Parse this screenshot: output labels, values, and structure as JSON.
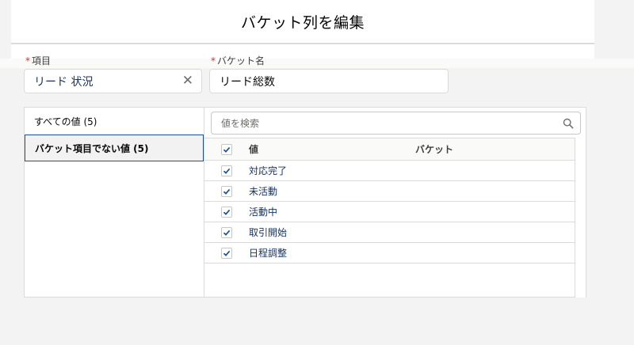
{
  "header": {
    "title": "バケット列を編集"
  },
  "fields": {
    "item": {
      "required_mark": "*",
      "label": "項目",
      "value": "リード 状況"
    },
    "bucket_name": {
      "required_mark": "*",
      "label": "バケット名",
      "value": "リード総数"
    }
  },
  "left_list": {
    "items": [
      {
        "label": "すべての値 (5)"
      },
      {
        "label": "バケット項目でない値 (5)"
      }
    ]
  },
  "search": {
    "placeholder": "値を検索"
  },
  "table": {
    "headers": {
      "value": "値",
      "bucket": "バケット"
    },
    "rows": [
      {
        "value": "対応完了",
        "bucket": ""
      },
      {
        "value": "未活動",
        "bucket": ""
      },
      {
        "value": "活動中",
        "bucket": ""
      },
      {
        "value": "取引開始",
        "bucket": ""
      },
      {
        "value": "日程調整",
        "bucket": ""
      }
    ]
  },
  "colors": {
    "accent": "#1b5297",
    "link": "#16325c",
    "required": "#c23934",
    "check": "#1b5297"
  }
}
